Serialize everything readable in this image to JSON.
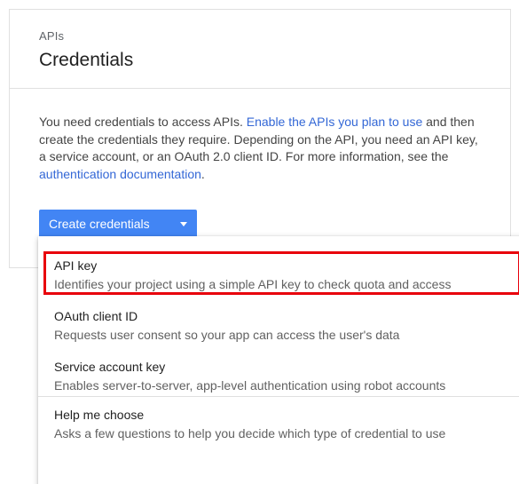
{
  "header": {
    "breadcrumb": "APIs",
    "title": "Credentials"
  },
  "intro": {
    "text_1": "You need credentials to access APIs. ",
    "link_enable": "Enable the APIs you plan to use",
    "text_2": " and then create the credentials they require. Depending on the API, you need an API key, a service account, or an OAuth 2.0 client ID. For more information, see the ",
    "link_docs": "authentication documentation",
    "text_3": "."
  },
  "create_button": {
    "label": "Create credentials"
  },
  "menu": {
    "items": [
      {
        "title": "API key",
        "description": "Identifies your project using a simple API key to check quota and access"
      },
      {
        "title": "OAuth client ID",
        "description": "Requests user consent so your app can access the user's data"
      },
      {
        "title": "Service account key",
        "description": "Enables server-to-server, app-level authentication using robot accounts"
      },
      {
        "title": "Help me choose",
        "description": "Asks a few questions to help you decide which type of credential to use"
      }
    ]
  },
  "colors": {
    "accent": "#4285f4",
    "link": "#3367d6",
    "highlight": "#e8000b"
  },
  "icons": {
    "dropdown_caret": "caret-down-icon"
  }
}
